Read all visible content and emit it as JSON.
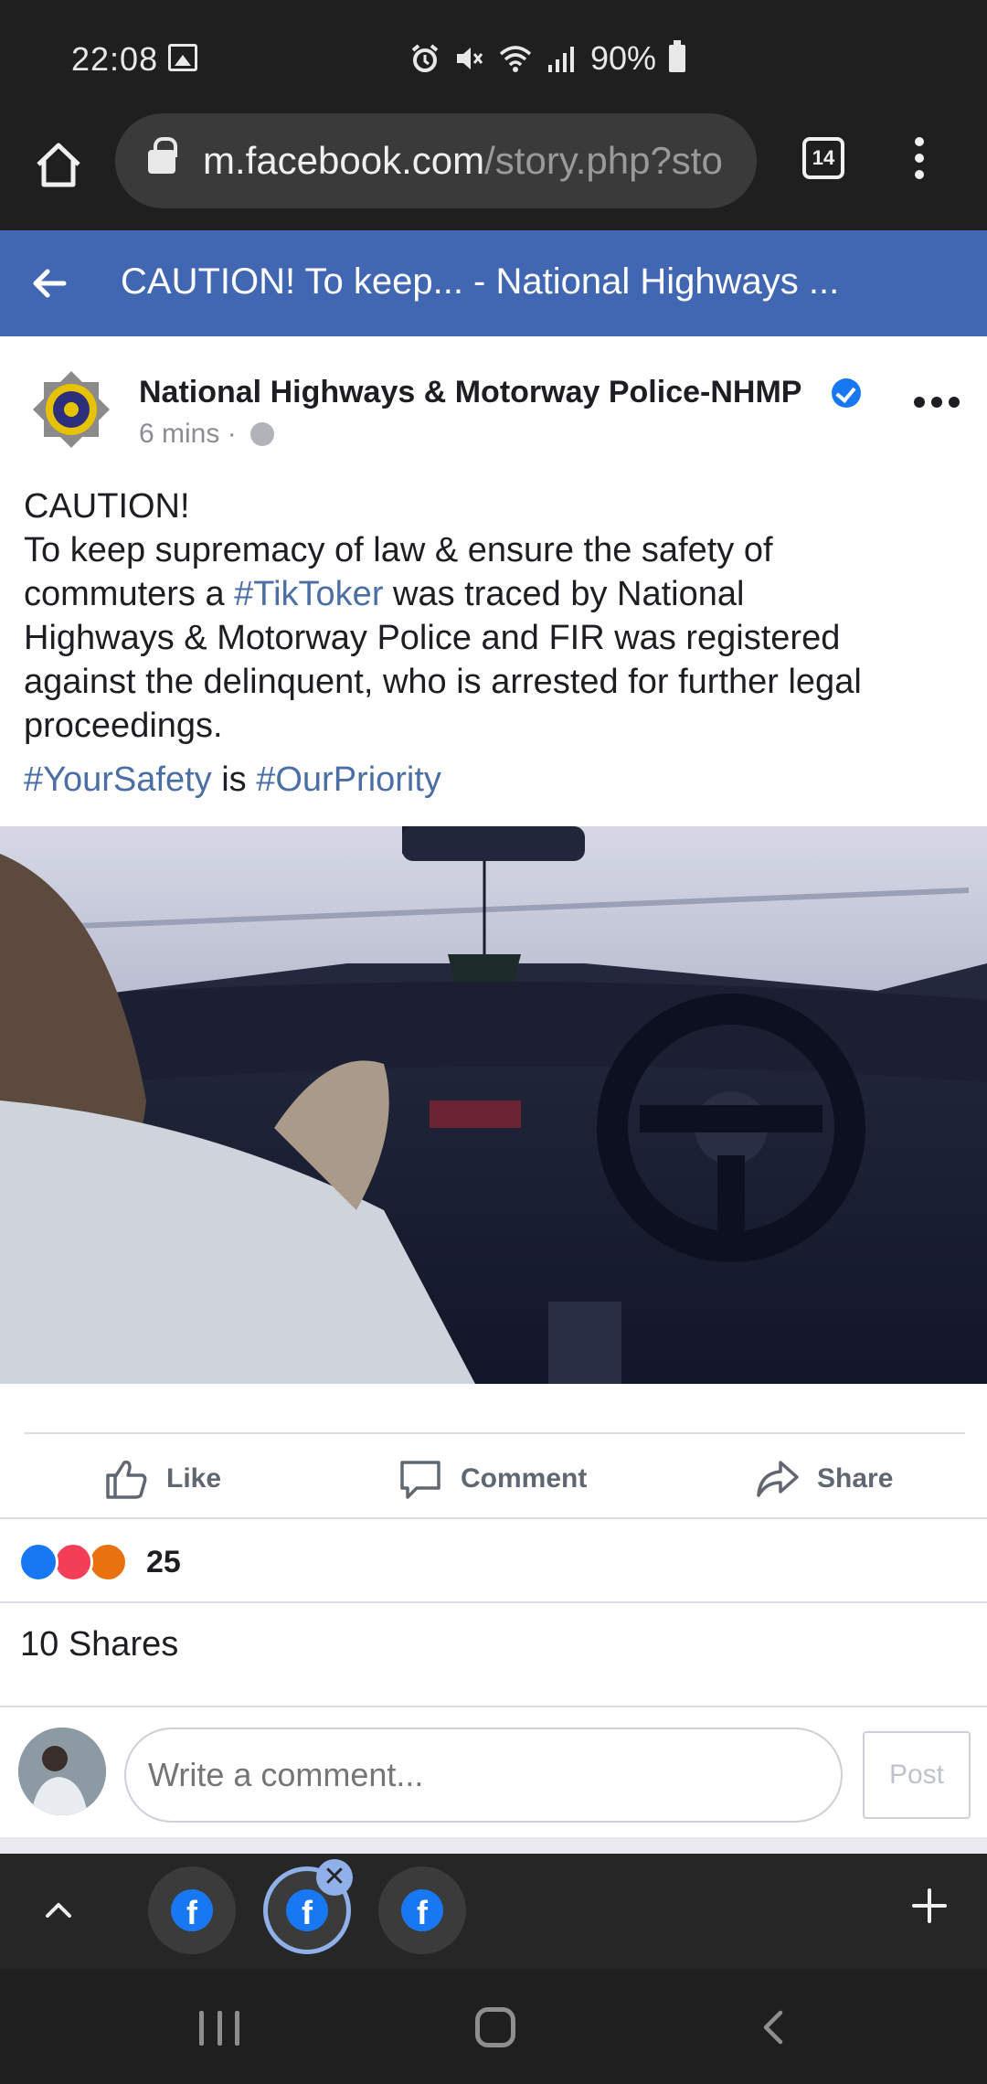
{
  "status_bar": {
    "time": "22:08",
    "battery": "90%",
    "icons": [
      "image-icon",
      "alarm-icon",
      "mute-icon",
      "wifi-icon",
      "signal-icon",
      "battery-icon"
    ]
  },
  "browser": {
    "url_main": "m.facebook.com",
    "url_rest": "/story.php?sto",
    "tab_count": "14"
  },
  "fb_header": {
    "title": "CAUTION! To keep... - National Highways ..."
  },
  "post": {
    "page_name": "National Highways & Motorway Police-NHMP",
    "time": "6 mins ·",
    "text_line1": "CAUTION!",
    "text_line2": "To keep supremacy of law & ensure the safety of",
    "text_line3_a": "commuters a ",
    "text_line3_tag": "#TikToker",
    "text_line3_b": " was traced by National",
    "text_line4": "Highways & Motorway Police and FIR was registered",
    "text_line5": "against the delinquent, who is arrested for further legal",
    "text_line6": "proceedings.",
    "tag1": "#YourSafety",
    "tag_between": " is ",
    "tag2": "#OurPriority"
  },
  "actions": {
    "like": "Like",
    "comment": "Comment",
    "share": "Share"
  },
  "reactions": {
    "count": "25"
  },
  "shares": "10 Shares",
  "comment_box": {
    "placeholder": "Write a comment...",
    "post_label": "Post"
  },
  "tab_strip": {
    "close_glyph": "✕",
    "plus_glyph": "+",
    "fb_glyph": "f"
  },
  "colors": {
    "fb_blue": "#4267b2",
    "hashtag": "#4b6ea4",
    "dark_bar": "#1f1f1f"
  }
}
